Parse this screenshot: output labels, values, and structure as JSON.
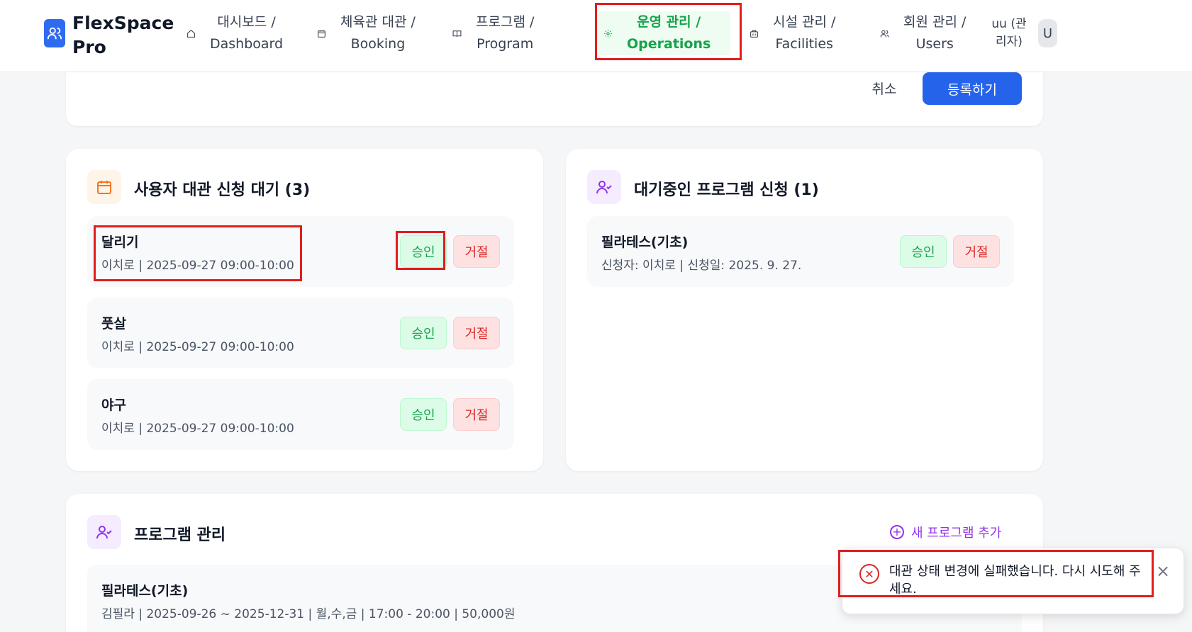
{
  "app": {
    "brand": "FlexSpace Pro"
  },
  "nav": {
    "items": [
      {
        "label": "대시보드 /\nDashboard",
        "icon": "home-icon"
      },
      {
        "label": "체육관 대관 /\nBooking",
        "icon": "calendar-icon"
      },
      {
        "label": "프로그램 /\nProgram",
        "icon": "book-icon"
      },
      {
        "label": "운영 관리 /\nOperations",
        "icon": "gear-icon",
        "active": true
      },
      {
        "label": "시설 관리 /\nFacilities",
        "icon": "building-icon"
      },
      {
        "label": "회원 관리 /\nUsers",
        "icon": "users-icon"
      }
    ]
  },
  "user": {
    "name": "uu (관리자)",
    "avatar": "U"
  },
  "form": {
    "cancel_label": "취소",
    "submit_label": "등록하기"
  },
  "booking_requests": {
    "title": "사용자 대관 신청 대기 (3)",
    "items": [
      {
        "title": "달리기",
        "sub": "이치로 | 2025-09-27 09:00-10:00"
      },
      {
        "title": "풋살",
        "sub": "이치로 | 2025-09-27 09:00-10:00"
      },
      {
        "title": "야구",
        "sub": "이치로 | 2025-09-27 09:00-10:00"
      }
    ],
    "approve_label": "승인",
    "reject_label": "거절"
  },
  "program_requests": {
    "title": "대기중인 프로그램 신청 (1)",
    "items": [
      {
        "title": "필라테스(기초)",
        "sub": "신청자: 이치로 | 신청일: 2025. 9. 27."
      }
    ],
    "approve_label": "승인",
    "reject_label": "거절"
  },
  "program_management": {
    "title": "프로그램 관리",
    "add_label": "새 프로그램 추가",
    "items": [
      {
        "title": "필라테스(기초)",
        "sub": "김필라 | 2025-09-26 ~ 2025-12-31 | 월,수,금 | 17:00 - 20:00 | 50,000원"
      }
    ]
  },
  "toast": {
    "message": "대관 상태 변경에 실패했습니다. 다시 시도해 주세요."
  },
  "colors": {
    "primary": "#2563eb",
    "success": "#16a34a",
    "danger": "#dc2626",
    "purple": "#9333ea",
    "orange": "#f97316"
  }
}
